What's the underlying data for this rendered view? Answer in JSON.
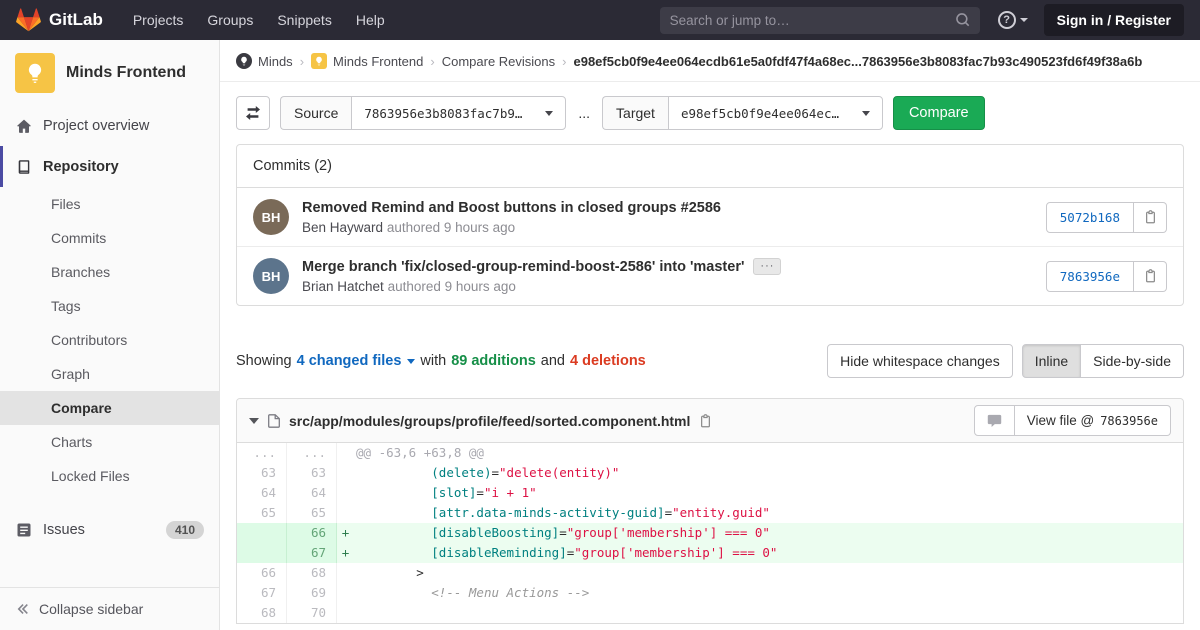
{
  "colors": {
    "navbar_bg": "#2b2a35",
    "brand_orange": "#e24329",
    "button_green": "#1aaa55",
    "link_blue": "#1068bf",
    "addition_green": "#168f48",
    "deletion_red": "#db3b21",
    "sidebar_bg": "#fafafa",
    "active_accent": "#4b4ba3",
    "added_line_bg": "#ecfdf0",
    "added_gutter_bg": "#ddfbe6"
  },
  "icons": {
    "help": "?",
    "ellipsis": "···"
  },
  "navbar": {
    "brand": "GitLab",
    "menu": [
      {
        "label": "Projects"
      },
      {
        "label": "Groups"
      },
      {
        "label": "Snippets"
      },
      {
        "label": "Help"
      }
    ],
    "search_placeholder": "Search or jump to…",
    "signin_label": "Sign in / Register"
  },
  "sidebar": {
    "project_name": "Minds Frontend",
    "overview_label": "Project overview",
    "repository_label": "Repository",
    "repo_items": [
      {
        "label": "Files",
        "active": false
      },
      {
        "label": "Commits",
        "active": false
      },
      {
        "label": "Branches",
        "active": false
      },
      {
        "label": "Tags",
        "active": false
      },
      {
        "label": "Contributors",
        "active": false
      },
      {
        "label": "Graph",
        "active": false
      },
      {
        "label": "Compare",
        "active": true
      },
      {
        "label": "Charts",
        "active": false
      },
      {
        "label": "Locked Files",
        "active": false
      }
    ],
    "issues_label": "Issues",
    "issues_count": "410",
    "collapse_label": "Collapse sidebar"
  },
  "breadcrumb": {
    "separator": "›",
    "links": [
      {
        "label": "Minds",
        "avatar": "dark"
      },
      {
        "label": "Minds Frontend",
        "avatar": "yellow"
      },
      {
        "label": "Compare Revisions"
      }
    ],
    "current": "e98ef5cb0f9e4ee064ecdb61e5a0fdf47f4a68ec...7863956e3b8083fac7b93c490523fd6f49f38a6b"
  },
  "compare_form": {
    "source_label": "Source",
    "source_value": "7863956e3b8083fac7b9…",
    "separator": "...",
    "target_label": "Target",
    "target_value": "e98ef5cb0f9e4ee064ec…",
    "compare_button": "Compare"
  },
  "commits": {
    "title": "Commits (2)",
    "items": [
      {
        "avatar_initials": "BH",
        "avatar_color": "#7a6a58",
        "title": "Removed Remind and Boost buttons in closed groups #2586",
        "expander": false,
        "author": "Ben Hayward",
        "meta": "authored 9 hours ago",
        "sha": "5072b168"
      },
      {
        "avatar_initials": "BH",
        "avatar_color": "#5c748c",
        "title": "Merge branch 'fix/closed-group-remind-boost-2586' into 'master'",
        "expander": true,
        "author": "Brian Hatchet",
        "meta": "authored 9 hours ago",
        "sha": "7863956e"
      }
    ]
  },
  "diff_summary": {
    "showing_prefix": "Showing",
    "changed_files": "4 changed files",
    "with_text": "with",
    "additions": "89 additions",
    "and_text": "and",
    "deletions": "4 deletions",
    "hide_whitespace_button": "Hide whitespace changes",
    "inline_button": "Inline",
    "side_by_side_button": "Side-by-side",
    "active_view": "Inline"
  },
  "diff_file": {
    "path": "src/app/modules/groups/profile/feed/sorted.component.html",
    "view_file_prefix": "View file @",
    "view_file_sha": "7863956e",
    "lines": [
      {
        "type": "hunk",
        "old": "...",
        "new": "...",
        "segments": [
          {
            "c": "hunk",
            "t": "@@ -63,6 +63,8 @@"
          }
        ]
      },
      {
        "type": "context",
        "old": "63",
        "new": "63",
        "segments": [
          {
            "c": "plain",
            "t": "          "
          },
          {
            "c": "attr",
            "t": "(delete)"
          },
          {
            "c": "plain",
            "t": "="
          },
          {
            "c": "string",
            "t": "\"delete(entity)\""
          }
        ]
      },
      {
        "type": "context",
        "old": "64",
        "new": "64",
        "segments": [
          {
            "c": "plain",
            "t": "          "
          },
          {
            "c": "attr",
            "t": "[slot]"
          },
          {
            "c": "plain",
            "t": "="
          },
          {
            "c": "string",
            "t": "\"i + 1\""
          }
        ]
      },
      {
        "type": "context",
        "old": "65",
        "new": "65",
        "segments": [
          {
            "c": "plain",
            "t": "          "
          },
          {
            "c": "attr",
            "t": "[attr.data-minds-activity-guid]"
          },
          {
            "c": "plain",
            "t": "="
          },
          {
            "c": "string",
            "t": "\"entity.guid\""
          }
        ]
      },
      {
        "type": "add",
        "old": "",
        "new": "66",
        "segments": [
          {
            "c": "plain",
            "t": "          "
          },
          {
            "c": "attr",
            "t": "[disableBoosting]"
          },
          {
            "c": "plain",
            "t": "="
          },
          {
            "c": "string",
            "t": "\"group['membership'] === 0\""
          }
        ]
      },
      {
        "type": "add",
        "old": "",
        "new": "67",
        "segments": [
          {
            "c": "plain",
            "t": "          "
          },
          {
            "c": "attr",
            "t": "[disableReminding]"
          },
          {
            "c": "plain",
            "t": "="
          },
          {
            "c": "string",
            "t": "\"group['membership'] === 0\""
          }
        ]
      },
      {
        "type": "context",
        "old": "66",
        "new": "68",
        "segments": [
          {
            "c": "plain",
            "t": "        >"
          }
        ]
      },
      {
        "type": "context",
        "old": "67",
        "new": "69",
        "segments": [
          {
            "c": "plain",
            "t": "          "
          },
          {
            "c": "comment",
            "t": "<!-- Menu Actions -->"
          }
        ]
      },
      {
        "type": "context",
        "old": "68",
        "new": "70",
        "segments": [
          {
            "c": "plain",
            "t": ""
          }
        ]
      }
    ]
  }
}
